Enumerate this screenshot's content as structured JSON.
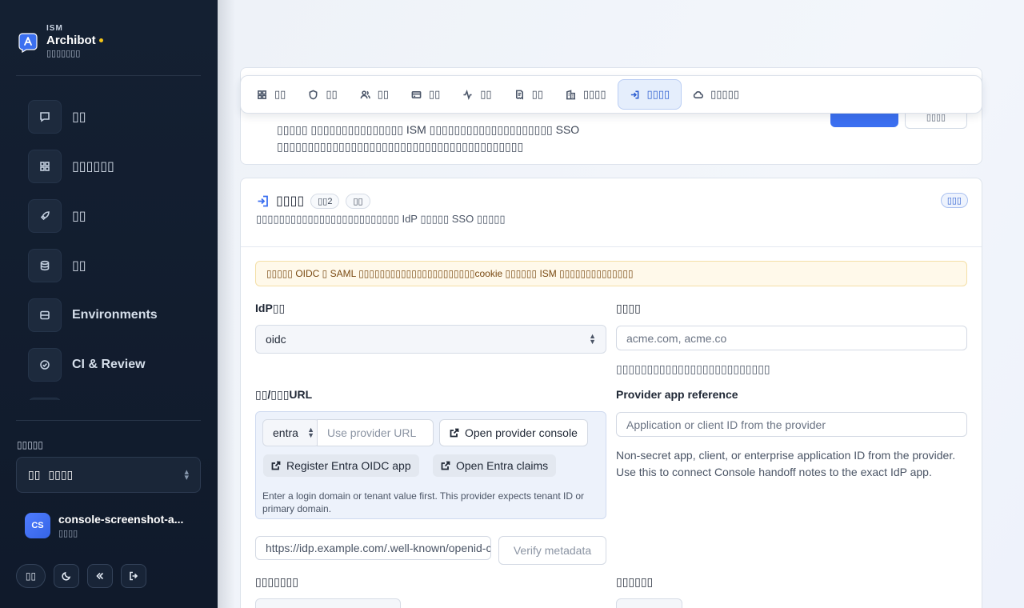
{
  "brand": {
    "eyebrow": "ISM",
    "title": "Archibot",
    "subtitle": "▯▯▯▯▯▯▯"
  },
  "nav": [
    {
      "label": "▯▯",
      "icon": "chat-icon"
    },
    {
      "label": "▯▯▯▯▯▯",
      "icon": "grid-icon"
    },
    {
      "label": "▯▯",
      "icon": "rocket-icon"
    },
    {
      "label": "▯▯",
      "icon": "database-icon"
    },
    {
      "label": "Environments",
      "icon": "server-icon"
    },
    {
      "label": "CI & Review",
      "icon": "check-circle-icon"
    }
  ],
  "workspace": {
    "label": "▯▯▯▯▯",
    "flag": "▯▯",
    "name": "▯▯▯▯"
  },
  "user": {
    "initials": "CS",
    "name": "console-screenshot-a...",
    "role": "▯▯▯▯"
  },
  "footer_buttons": {
    "lang": "▯▯"
  },
  "tabs": [
    {
      "label": "▯▯",
      "icon": "grid-icon",
      "active": false
    },
    {
      "label": "▯▯",
      "icon": "shield-icon",
      "active": false
    },
    {
      "label": "▯▯",
      "icon": "users-icon",
      "active": false
    },
    {
      "label": "▯▯",
      "icon": "card-icon",
      "active": false
    },
    {
      "label": "▯▯",
      "icon": "activity-icon",
      "active": false
    },
    {
      "label": "▯▯",
      "icon": "receipt-icon",
      "active": false
    },
    {
      "label": "▯▯▯▯",
      "icon": "building-icon",
      "active": false
    },
    {
      "label": "▯▯▯▯",
      "icon": "login-icon",
      "active": true
    },
    {
      "label": "▯▯▯▯▯",
      "icon": "cloud-icon",
      "active": false
    }
  ],
  "top_card": {
    "description": "▯▯▯▯▯ ▯▯▯▯▯▯▯▯▯▯▯▯▯▯▯ ISM ▯▯▯▯▯▯▯▯▯▯▯▯▯▯▯▯▯▯▯▯ SSO ▯▯▯▯▯▯▯▯▯▯▯▯▯▯▯▯▯▯▯▯▯▯▯▯▯▯▯▯▯▯▯▯▯▯▯▯▯▯▯▯",
    "secondary_button": "▯▯▯▯"
  },
  "sso": {
    "title": "▯▯▯▯",
    "count_pill": "▯▯2",
    "status_pill": "▯▯",
    "right_pill": "▯▯▯",
    "description": "▯▯▯▯▯▯▯▯▯▯▯▯▯▯▯▯▯▯▯▯▯▯▯▯▯ IdP ▯▯▯▯▯ SSO ▯▯▯▯▯",
    "warning": "▯▯▯▯▯ OIDC ▯ SAML ▯▯▯▯▯▯▯▯▯▯▯▯▯▯▯▯▯▯▯▯▯▯cookie ▯▯▯▯▯▯ ISM ▯▯▯▯▯▯▯▯▯▯▯▯▯▯",
    "idp_type_label": "IdP▯▯",
    "idp_type_value": "oidc",
    "domains_label": "▯▯▯▯",
    "domains_placeholder": "acme.com, acme.co",
    "domains_help": "▯▯▯▯▯▯▯▯▯▯▯▯▯▯▯▯▯▯▯▯▯▯▯▯▯",
    "provider_url_label": "▯▯/▯▯▯URL",
    "provider_select": "entra",
    "provider_url_placeholder": "Use provider URL",
    "open_console": "Open provider console",
    "register_app": "Register Entra OIDC app",
    "open_claims": "Open Entra claims",
    "provider_help": "Enter a login domain or tenant value first. This provider expects tenant ID or primary domain.",
    "app_ref_label": "Provider app reference",
    "app_ref_placeholder": "Application or client ID from the provider",
    "app_ref_help": "Non-secret app, client, or enterprise application ID from the provider. Use this to connect Console handoff notes to the exact IdP app.",
    "metadata_url": "https://idp.example.com/.well-known/openid-configuration",
    "verify_metadata": "Verify metadata",
    "bottom_left_label": "▯▯▯▯▯▯▯",
    "bottom_right_label": "▯▯▯▯▯▯"
  },
  "colors": {
    "accent": "#3b6ff0",
    "sidebar": "#142032",
    "warning_bg": "#fff9ea"
  }
}
